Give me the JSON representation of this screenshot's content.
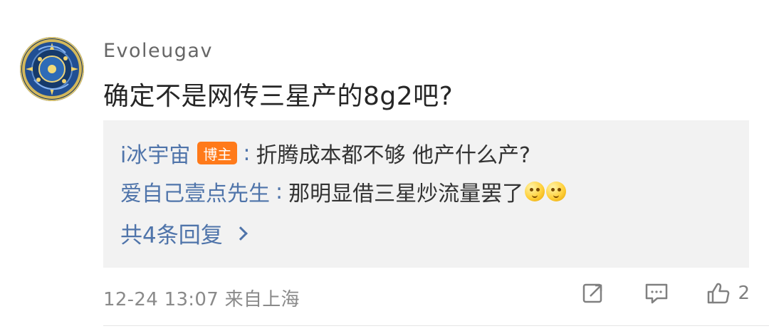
{
  "comment": {
    "username": "Evoleugav",
    "text": "确定不是网传三星产的8g2吧?",
    "replies": [
      {
        "author": "i冰宇宙",
        "badge": "博主",
        "colon": ":",
        "text": "折腾成本都不够  他产什么产?"
      },
      {
        "author": "爱自己壹点先生",
        "colon": ":",
        "text": "那明显借三星炒流量罢了"
      }
    ],
    "more_replies": "共4条回复",
    "meta": "12-24 13:07  来自上海",
    "like_count": "2"
  },
  "icons": {
    "avatar": "avatar-icon",
    "emoji": "thinking-emoji-icon",
    "share": "share-icon",
    "comment": "comment-icon",
    "like": "thumb-up-icon",
    "chevron": "chevron-right-icon"
  },
  "colors": {
    "username": "#666666",
    "comment_text": "#262626",
    "reply_author": "#4f74aa",
    "reply_text": "#333333",
    "reply_box_background": "#f2f2f2",
    "badge": "#ff7a1a",
    "meta": "#8a8a8a"
  }
}
